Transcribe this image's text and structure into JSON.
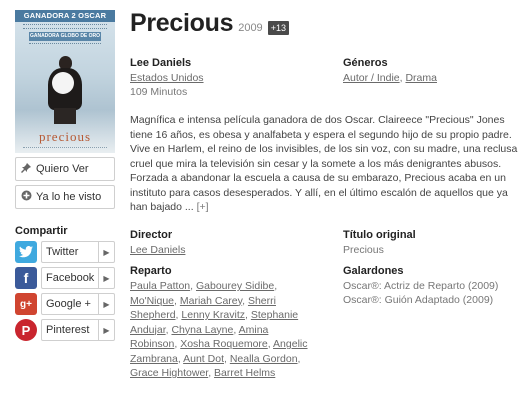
{
  "poster": {
    "banner_main": "GANADORA 2 OSCAR",
    "banner_secondary": "GANADORA GLOBO DE ORO",
    "title": "precious"
  },
  "sidebar": {
    "wishlist_label": "Quiero Ver",
    "seen_label": "Ya lo he visto",
    "share_title": "Compartir",
    "share": [
      {
        "label": "Twitter",
        "icon": "twitter-icon",
        "color": "#3fa9df"
      },
      {
        "label": "Facebook",
        "icon": "facebook-icon",
        "color": "#3b5a9a"
      },
      {
        "label": "Google +",
        "icon": "google-plus-icon",
        "color": "#d04530"
      },
      {
        "label": "Pinterest",
        "icon": "pinterest-icon",
        "color": "#c9252e"
      }
    ]
  },
  "movie": {
    "title": "Precious",
    "year": "2009",
    "age_rating": "+13",
    "director_name": "Lee Daniels",
    "country": "Estados Unidos",
    "duration": "109 Minutos",
    "genres_heading": "Géneros",
    "genres": [
      "Autor / Indie",
      "Drama"
    ],
    "genre_separator": ", ",
    "synopsis": "Magnífica e intensa película ganadora de dos Oscar. Claireece \"Precious\" Jones tiene 16 años, es obesa y analfabeta y espera el segundo hijo de su propio padre. Vive en Harlem, el reino de los invisibles, de los sin voz, con su madre, una reclusa cruel que mira la televisión sin cesar y la somete a los más denigrantes abusos. Forzada a abandonar la escuela a causa de su embarazo, Precious acaba en un instituto para casos desesperados. Y allí, en el último escalón de aquellos que ya han bajado ...",
    "more_link": "[+]",
    "director_heading": "Director",
    "director": "Lee Daniels",
    "original_title_heading": "Título original",
    "original_title": "Precious",
    "cast_heading": "Reparto",
    "cast": [
      "Paula Patton",
      "Gabourey Sidibe",
      "Mo'Nique",
      "Mariah Carey",
      "Sherri Shepherd",
      "Lenny Kravitz",
      "Stephanie Andujar",
      "Chyna Layne",
      "Amina Robinson",
      "Xosha Roquemore",
      "Angelic Zambrana",
      "Aunt Dot",
      "Nealla Gordon",
      "Grace Hightower",
      "Barret Helms"
    ],
    "awards_heading": "Galardones",
    "awards": [
      "Oscar®: Actriz de Reparto (2009)",
      "Oscar®: Guión Adaptado (2009)"
    ]
  }
}
